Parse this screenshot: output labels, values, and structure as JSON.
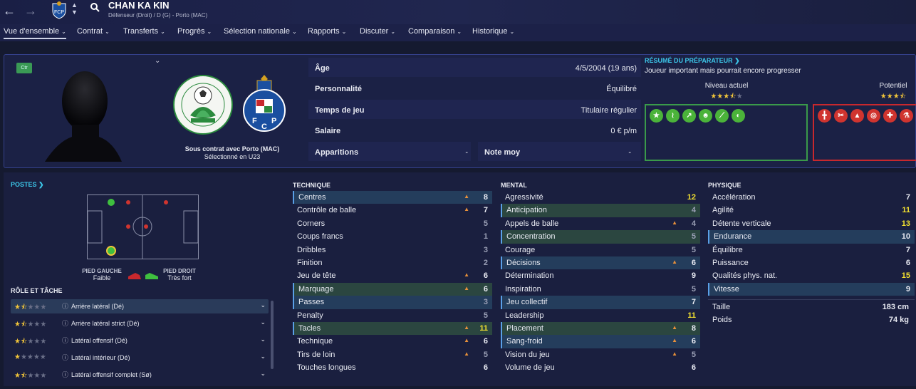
{
  "header": {
    "name": "CHAN KA KIN",
    "subtitle": "Défenseur (Droit) / D (G) - Porto (MAC)",
    "back": "←",
    "forward": "→"
  },
  "menu": [
    {
      "label": "Vue d'ensemble"
    },
    {
      "label": "Contrat"
    },
    {
      "label": "Transferts"
    },
    {
      "label": "Progrès"
    },
    {
      "label": "Sélection nationale"
    },
    {
      "label": "Rapports"
    },
    {
      "label": "Discuter"
    },
    {
      "label": "Comparaison"
    },
    {
      "label": "Historique"
    }
  ],
  "profile": {
    "badge": "Ctr",
    "contract_line1": "Sous contrat avec Porto (MAC)",
    "contract_line2": "Sélectionné en U23"
  },
  "info": {
    "age_label": "Âge",
    "age": "4/5/2004 (19 ans)",
    "pers_label": "Personnalité",
    "pers": "Équilibré",
    "time_label": "Temps de jeu",
    "time": "Titulaire régulier",
    "salary_label": "Salaire",
    "salary": "0 € p/m",
    "apps_label": "Apparitions",
    "apps": "-",
    "note_label": "Note moy",
    "note": "-"
  },
  "scout": {
    "title": "RÉSUMÉ DU PRÉPARATEUR ❯",
    "desc": "Joueur important mais pourrait encore progresser",
    "current_label": "Niveau actuel",
    "current_stars": 3.5,
    "potential_label": "Potentiel",
    "potential_stars": 3.5
  },
  "colors": {
    "accent": "#3cc6e8",
    "star": "#f0c43a",
    "good": "#3a9a4a",
    "bad": "#c8282d",
    "trend": "#e8903a"
  },
  "positions": {
    "title": "POSTES ❯",
    "left_label": "PIED GAUCHE",
    "left_value": "Faible",
    "right_label": "PIED DROIT",
    "right_value": "Très fort"
  },
  "roles": {
    "title": "RÔLE ET TÂCHE",
    "items": [
      {
        "name": "Arrière latéral (Dé)",
        "stars": 1.5
      },
      {
        "name": "Arrière latéral strict (Dé)",
        "stars": 1.5
      },
      {
        "name": "Latéral offensif (Dé)",
        "stars": 1.5
      },
      {
        "name": "Latéral intérieur (Dé)",
        "stars": 1
      },
      {
        "name": "Latéral offensif complet (Sø)",
        "stars": 1.5
      }
    ]
  },
  "technique": {
    "title": "TECHNIQUE",
    "rows": [
      {
        "n": "Centres",
        "v": "8"
      },
      {
        "n": "Contrôle de balle",
        "v": "7"
      },
      {
        "n": "Corners",
        "v": "5"
      },
      {
        "n": "Coups francs",
        "v": "1"
      },
      {
        "n": "Dribbles",
        "v": "3"
      },
      {
        "n": "Finition",
        "v": "2"
      },
      {
        "n": "Jeu de tête",
        "v": "6"
      },
      {
        "n": "Marquage",
        "v": "6"
      },
      {
        "n": "Passes",
        "v": "3"
      },
      {
        "n": "Penalty",
        "v": "5"
      },
      {
        "n": "Tacles",
        "v": "11"
      },
      {
        "n": "Technique",
        "v": "6"
      },
      {
        "n": "Tirs de loin",
        "v": "5"
      },
      {
        "n": "Touches longues",
        "v": "6"
      }
    ]
  },
  "mental": {
    "title": "MENTAL",
    "rows": [
      {
        "n": "Agressivité",
        "v": "12"
      },
      {
        "n": "Anticipation",
        "v": "4"
      },
      {
        "n": "Appels de balle",
        "v": "4"
      },
      {
        "n": "Concentration",
        "v": "5"
      },
      {
        "n": "Courage",
        "v": "5"
      },
      {
        "n": "Décisions",
        "v": "6"
      },
      {
        "n": "Détermination",
        "v": "9"
      },
      {
        "n": "Inspiration",
        "v": "5"
      },
      {
        "n": "Jeu collectif",
        "v": "7"
      },
      {
        "n": "Leadership",
        "v": "11"
      },
      {
        "n": "Placement",
        "v": "8"
      },
      {
        "n": "Sang-froid",
        "v": "6"
      },
      {
        "n": "Vision du jeu",
        "v": "5"
      },
      {
        "n": "Volume de jeu",
        "v": "6"
      }
    ]
  },
  "physique": {
    "title": "PHYSIQUE",
    "rows": [
      {
        "n": "Accélération",
        "v": "7"
      },
      {
        "n": "Agilité",
        "v": "11"
      },
      {
        "n": "Détente verticale",
        "v": "13"
      },
      {
        "n": "Endurance",
        "v": "10"
      },
      {
        "n": "Équilibre",
        "v": "7"
      },
      {
        "n": "Puissance",
        "v": "6"
      },
      {
        "n": "Qualités phys. nat.",
        "v": "15"
      },
      {
        "n": "Vitesse",
        "v": "9"
      }
    ],
    "height_label": "Taille",
    "height": "183 cm",
    "weight_label": "Poids",
    "weight": "74 kg"
  }
}
